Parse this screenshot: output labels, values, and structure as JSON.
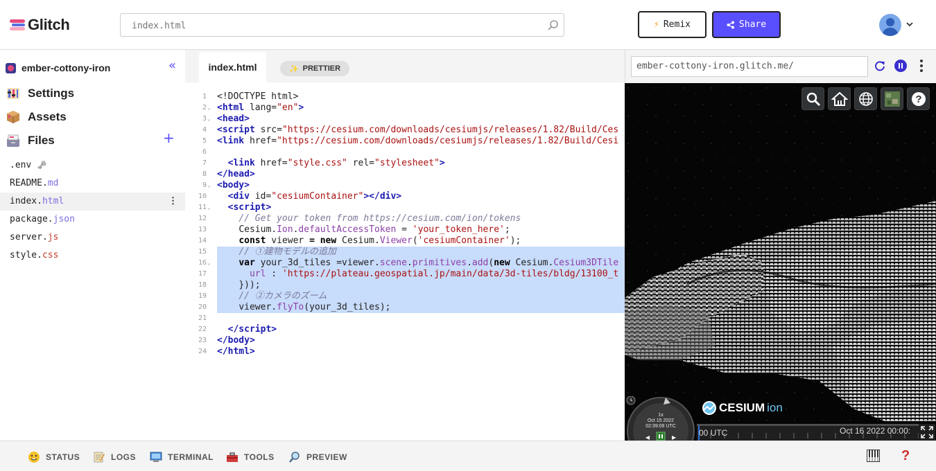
{
  "header": {
    "logo_text": "Glitch",
    "search_placeholder": "index.html",
    "remix_label": "Remix",
    "share_label": "Share"
  },
  "sidebar": {
    "project_name": "ember-cottony-iron",
    "nav": [
      {
        "label": "Settings",
        "icon": "settings-icon"
      },
      {
        "label": "Assets",
        "icon": "package-icon"
      },
      {
        "label": "Files",
        "icon": "file-box-icon"
      }
    ],
    "files": [
      {
        "base": ".env",
        "ext": "",
        "suffix": "🗝"
      },
      {
        "base": "README.",
        "ext": "md"
      },
      {
        "base": "index.",
        "ext": "html",
        "active": true
      },
      {
        "base": "package.",
        "ext": "json"
      },
      {
        "base": "server.",
        "ext": "js"
      },
      {
        "base": "style.",
        "ext": "css"
      }
    ]
  },
  "editor": {
    "active_tab": "index.html",
    "prettier_label": "PRETTIER",
    "line_numbers": [
      "1",
      "2",
      "3",
      "4",
      "5",
      "6",
      "7",
      "8",
      "9",
      "10",
      "11",
      "12",
      "13",
      "14",
      "15",
      "16",
      "17",
      "18",
      "19",
      "20",
      "21",
      "22",
      "23",
      "24"
    ]
  },
  "preview": {
    "url": "ember-cottony-iron.glitch.me/",
    "cesium_brand": "CESIUM",
    "cesium_ion": "ion",
    "speed": "1x",
    "clock_date": "Oct 15 2022",
    "clock_time": "02:39:09 UTC",
    "timeline_left": "00 UTC",
    "timeline_right": "Oct 16 2022 00:00:"
  },
  "bottombar": {
    "status": "STATUS",
    "logs": "LOGS",
    "terminal": "TERMINAL",
    "tools": "TOOLS",
    "preview": "PREVIEW",
    "help": "?"
  },
  "colors": {
    "accent": "#5a4fff",
    "selection": "#c8dcfb",
    "tag": "#1b1bb0",
    "string": "#aa1111"
  }
}
